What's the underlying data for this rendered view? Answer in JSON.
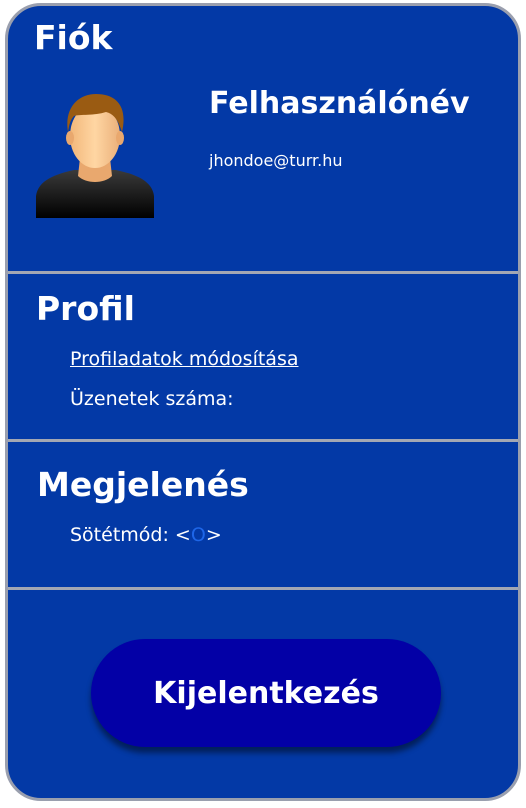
{
  "account": {
    "title": "Fiók",
    "username": "Felhasználónév",
    "email": "jhondoe@turr.hu"
  },
  "profile": {
    "title": "Profil",
    "edit_link": "Profiladatok módosítása",
    "messages_label": "Üzenetek száma:"
  },
  "appearance": {
    "title": "Megjelenés",
    "dark_mode_label": "Sötétmód:",
    "toggle_left": "<",
    "toggle_state": "O",
    "toggle_right": ">"
  },
  "logout": {
    "label": "Kijelentkezés"
  },
  "colors": {
    "card_bg": "#0339a6",
    "button_bg": "#0300a6",
    "toggle_accent": "#1e66e8",
    "divider": "#a3a7b3"
  },
  "icons": {
    "avatar": "user-avatar-icon"
  }
}
